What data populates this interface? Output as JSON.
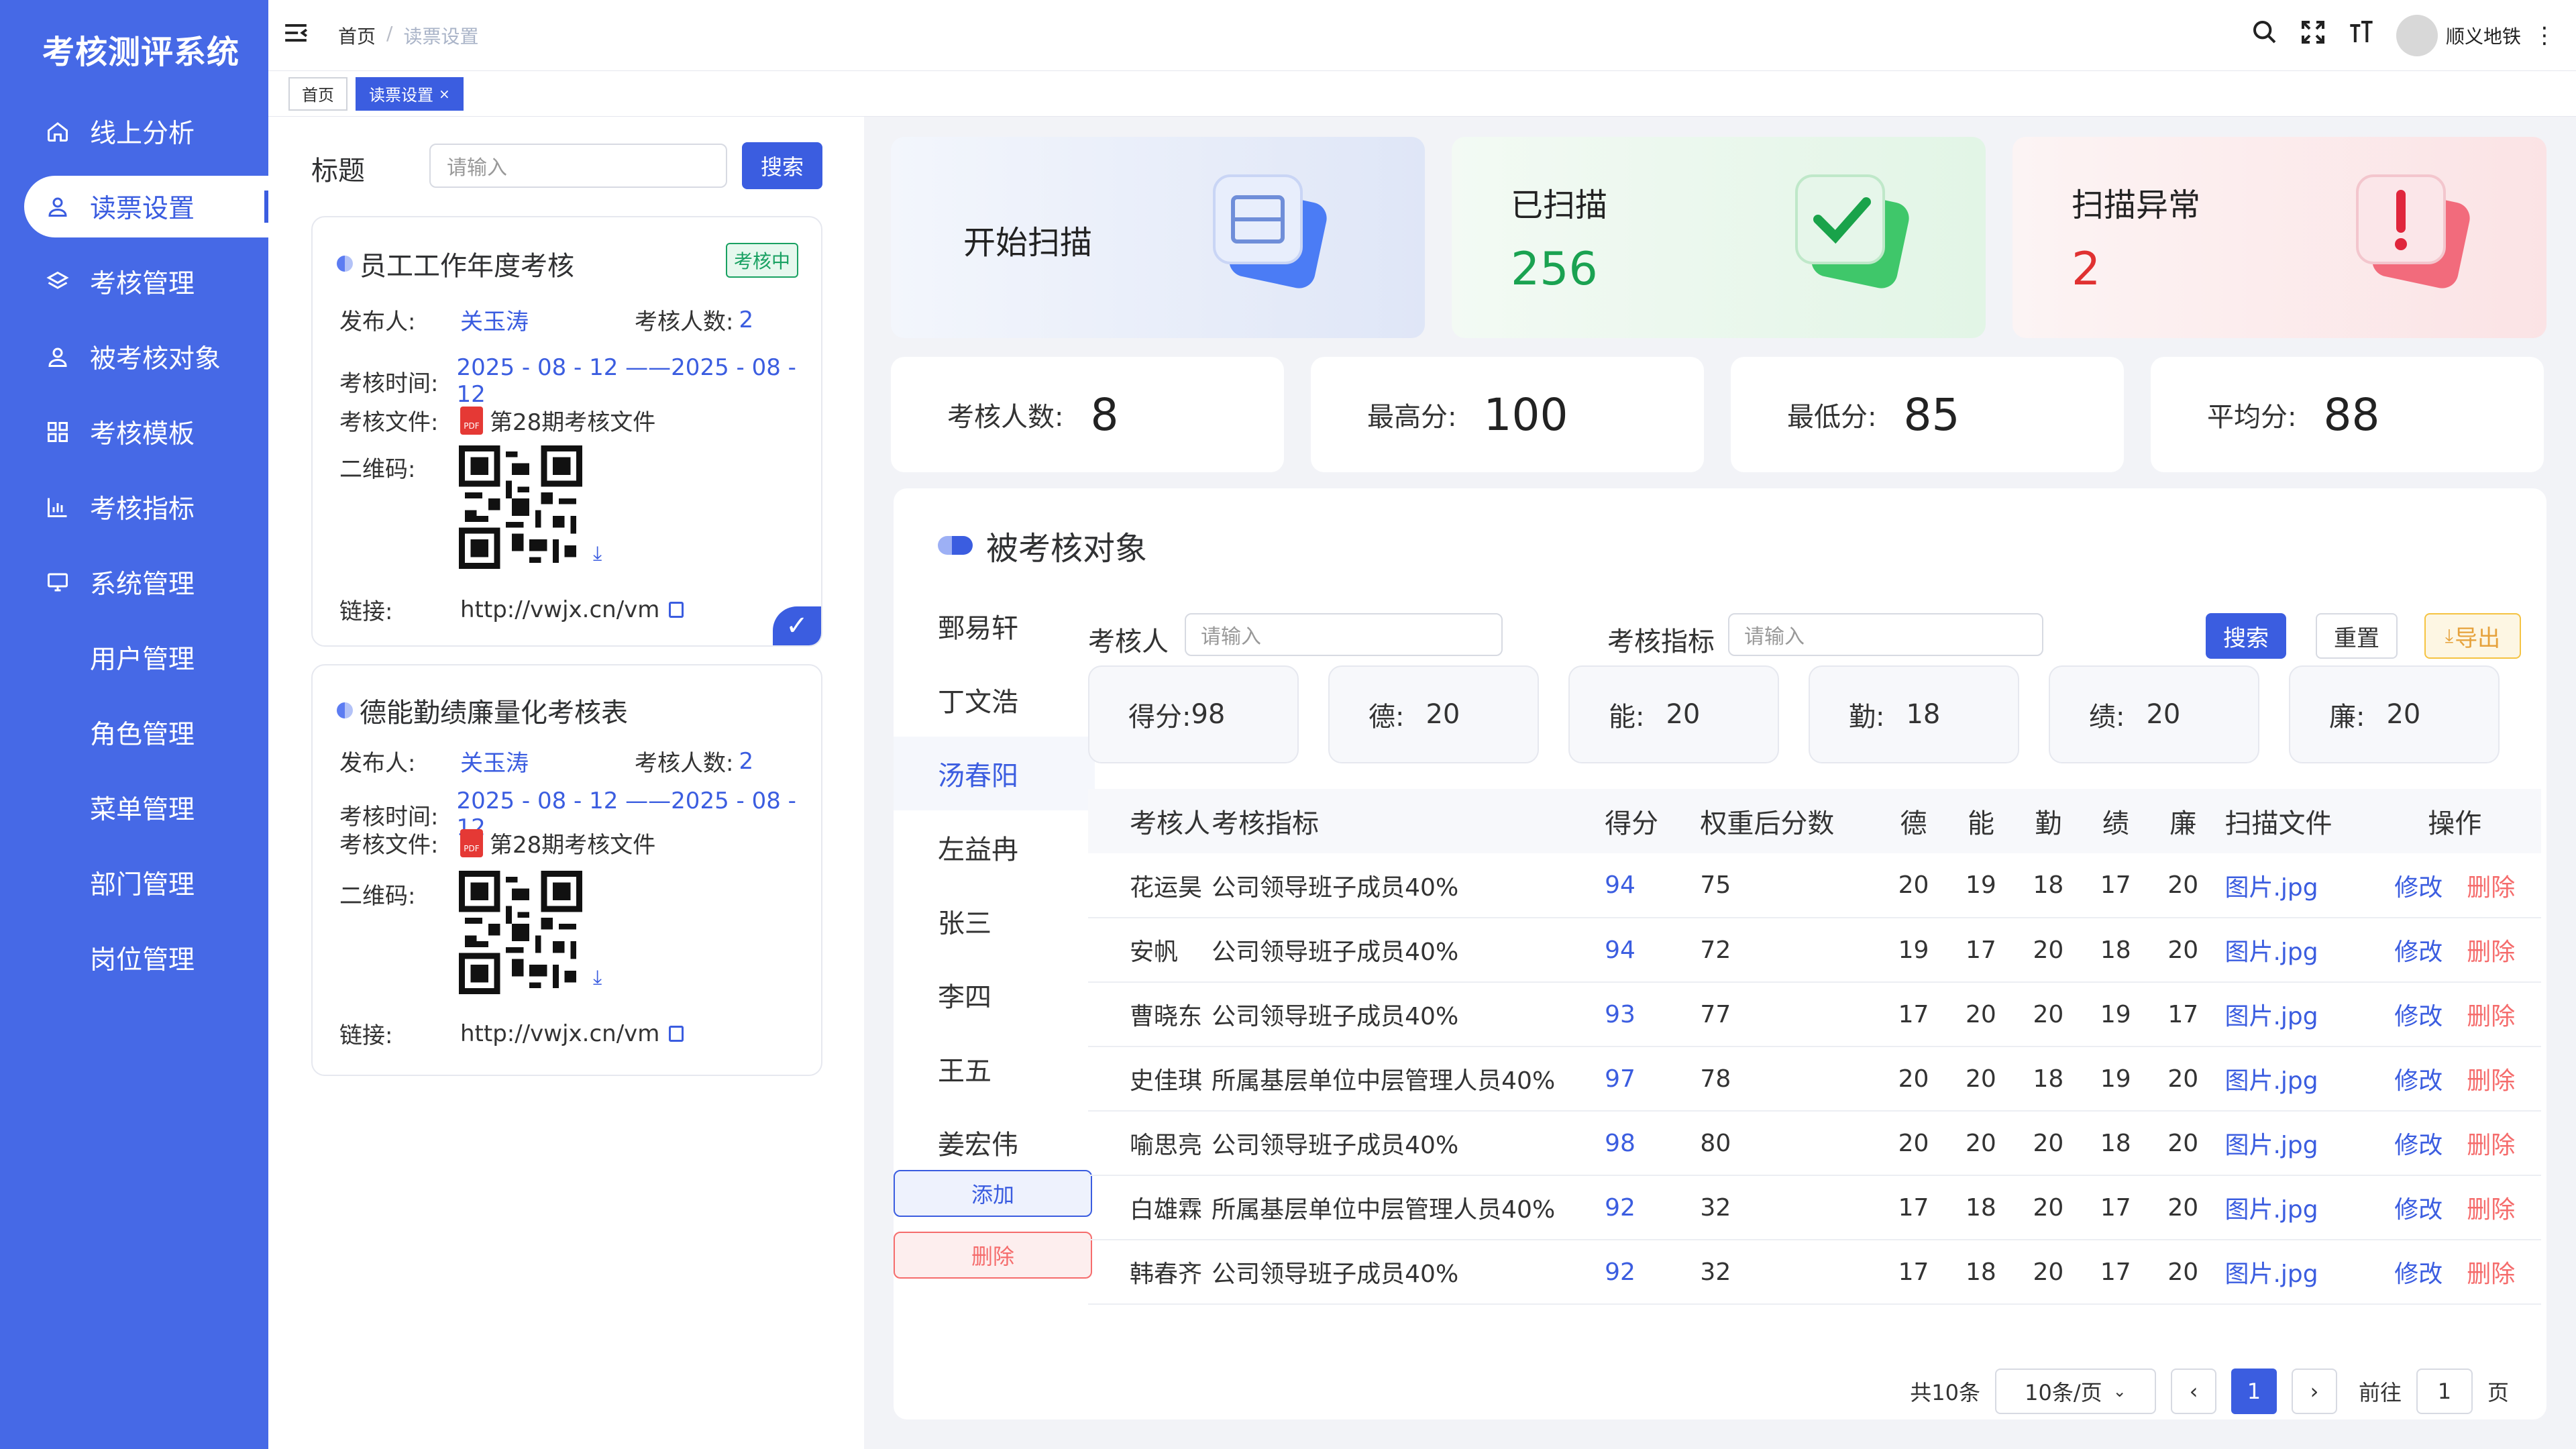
{
  "app": {
    "title": "考核测评系统"
  },
  "sidebar": {
    "items": [
      {
        "label": "线上分析",
        "icon": "home-icon"
      },
      {
        "label": "读票设置",
        "icon": "user-icon"
      },
      {
        "label": "考核管理",
        "icon": "layers-icon"
      },
      {
        "label": "被考核对象",
        "icon": "user-icon"
      },
      {
        "label": "考核模板",
        "icon": "grid-icon"
      },
      {
        "label": "考核指标",
        "icon": "chart-icon"
      },
      {
        "label": "系统管理",
        "icon": "monitor-icon"
      },
      {
        "label": "用户管理"
      },
      {
        "label": "角色管理"
      },
      {
        "label": "菜单管理"
      },
      {
        "label": "部门管理"
      },
      {
        "label": "岗位管理"
      }
    ]
  },
  "header": {
    "breadcrumb": [
      "首页",
      "读票设置"
    ],
    "username": "顺义地铁"
  },
  "tags": [
    "首页",
    "读票设置"
  ],
  "left": {
    "search_label": "标题",
    "search_placeholder": "请输入",
    "search_button": "搜索",
    "cards": [
      {
        "title": "员工工作年度考核",
        "badge": "考核中",
        "publisher_label": "发布人:",
        "publisher": "关玉涛",
        "count_label": "考核人数:",
        "count": "2",
        "time_label": "考核时间:",
        "time": "2025 - 08 - 12 ——2025 - 08 - 12",
        "file_label": "考核文件:",
        "file": "第28期考核文件",
        "qr_label": "二维码:",
        "link_label": "链接:",
        "link": "http://vwjx.cn/vm"
      },
      {
        "title": "德能勤绩廉量化考核表",
        "publisher_label": "发布人:",
        "publisher": "关玉涛",
        "count_label": "考核人数:",
        "count": "2",
        "time_label": "考核时间:",
        "time": "2025 - 08 - 12 ——2025 - 08 - 12",
        "file_label": "考核文件:",
        "file": "第28期考核文件",
        "qr_label": "二维码:",
        "link_label": "链接:",
        "link": "http://vwjx.cn/vm"
      }
    ]
  },
  "summary": [
    {
      "label": "开始扫描",
      "value": ""
    },
    {
      "label": "已扫描",
      "value": "256",
      "color": "#1aa251"
    },
    {
      "label": "扫描异常",
      "value": "2",
      "color": "#e03131"
    }
  ],
  "stats": [
    {
      "label": "考核人数:",
      "value": "8"
    },
    {
      "label": "最高分:",
      "value": "100"
    },
    {
      "label": "最低分:",
      "value": "85"
    },
    {
      "label": "平均分:",
      "value": "88"
    }
  ],
  "panel": {
    "title": "被考核对象",
    "names": [
      "鄄易轩",
      "丁文浩",
      "汤春阳",
      "左益冉",
      "张三",
      "李四",
      "王五",
      "姜宏伟"
    ],
    "selected_index": 2,
    "add_label": "添加",
    "delete_label": "删除",
    "filter": {
      "person_label": "考核人",
      "person_placeholder": "请输入",
      "index_label": "考核指标",
      "index_placeholder": "请输入",
      "search": "搜索",
      "reset": "重置",
      "export": "导出"
    },
    "scores": [
      {
        "label": "得分:",
        "value": "98"
      },
      {
        "label": "德:",
        "value": "20"
      },
      {
        "label": "能:",
        "value": "20"
      },
      {
        "label": "勤:",
        "value": "18"
      },
      {
        "label": "绩:",
        "value": "20"
      },
      {
        "label": "廉:",
        "value": "20"
      }
    ],
    "table": {
      "headers": [
        "考核人",
        "考核指标",
        "得分",
        "权重后分数",
        "德",
        "能",
        "勤",
        "绩",
        "廉",
        "扫描文件",
        "操作"
      ],
      "edit": "修改",
      "remove": "删除",
      "rows": [
        [
          "花运昊",
          "公司领导班子成员40%",
          "94",
          "75",
          "20",
          "19",
          "18",
          "17",
          "20",
          "图片.jpg"
        ],
        [
          "安帆",
          "公司领导班子成员40%",
          "94",
          "72",
          "19",
          "17",
          "20",
          "18",
          "20",
          "图片.jpg"
        ],
        [
          "曹晓东",
          "公司领导班子成员40%",
          "93",
          "77",
          "17",
          "20",
          "20",
          "19",
          "17",
          "图片.jpg"
        ],
        [
          "史佳琪",
          "所属基层单位中层管理人员40%",
          "97",
          "78",
          "20",
          "20",
          "18",
          "19",
          "20",
          "图片.jpg"
        ],
        [
          "喻思亮",
          "公司领导班子成员40%",
          "98",
          "80",
          "20",
          "20",
          "20",
          "18",
          "20",
          "图片.jpg"
        ],
        [
          "白雄霖",
          "所属基层单位中层管理人员40%",
          "92",
          "32",
          "17",
          "18",
          "20",
          "17",
          "20",
          "图片.jpg"
        ],
        [
          "韩春齐",
          "公司领导班子成员40%",
          "92",
          "32",
          "17",
          "18",
          "20",
          "17",
          "20",
          "图片.jpg"
        ]
      ]
    },
    "pager": {
      "total": "共10条",
      "size": "10条/页",
      "page": "1",
      "goto_label": "前往",
      "goto_value": "1",
      "page_suffix": "页"
    }
  }
}
